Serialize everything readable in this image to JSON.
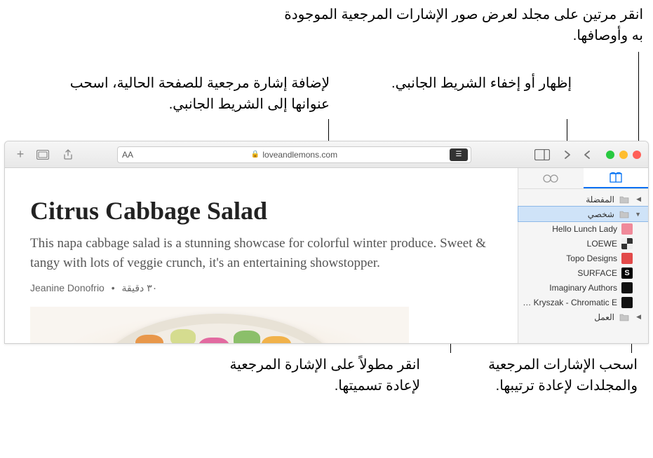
{
  "callouts": {
    "top_right": "انقر مرتين على مجلد لعرض صور الإشارات المرجعية الموجودة به وأوصافها.",
    "mid_right": "إظهار أو إخفاء الشريط الجانبي.",
    "mid_left": "لإضافة إشارة مرجعية للصفحة الحالية، اسحب عنوانها إلى الشريط الجانبي.",
    "bottom_right": "اسحب الإشارات المرجعية والمجلدات لإعادة ترتيبها.",
    "bottom_mid": "انقر مطولاً على الإشارة المرجعية لإعادة تسميتها."
  },
  "url": "loveandlemons.com",
  "url_aa": "AA",
  "sidebar": {
    "favorites": "المفضلة",
    "folder_personal": "شخصي",
    "folder_work": "العمل",
    "items": [
      {
        "label": "Hello Lunch Lady",
        "color": "#f08a9a"
      },
      {
        "label": "LOEWE",
        "color_pattern": true
      },
      {
        "label": "Topo Designs",
        "color": "#e24a4a"
      },
      {
        "label": "SURFACE",
        "letter": "S",
        "bg": "#000",
        "fg": "#fff"
      },
      {
        "label": "Imaginary Authors",
        "color": "#111"
      },
      {
        "label": "Neil Kryszak - Chromatic E...",
        "color": "#111"
      }
    ]
  },
  "article": {
    "title": "Citrus Cabbage Salad",
    "desc": "This napa cabbage salad is a stunning showcase for colorful winter produce. Sweet & tangy with lots of veggie crunch, it's an entertaining showstopper.",
    "author": "Jeanine Donofrio",
    "time": "٣٠ دقيقة"
  }
}
